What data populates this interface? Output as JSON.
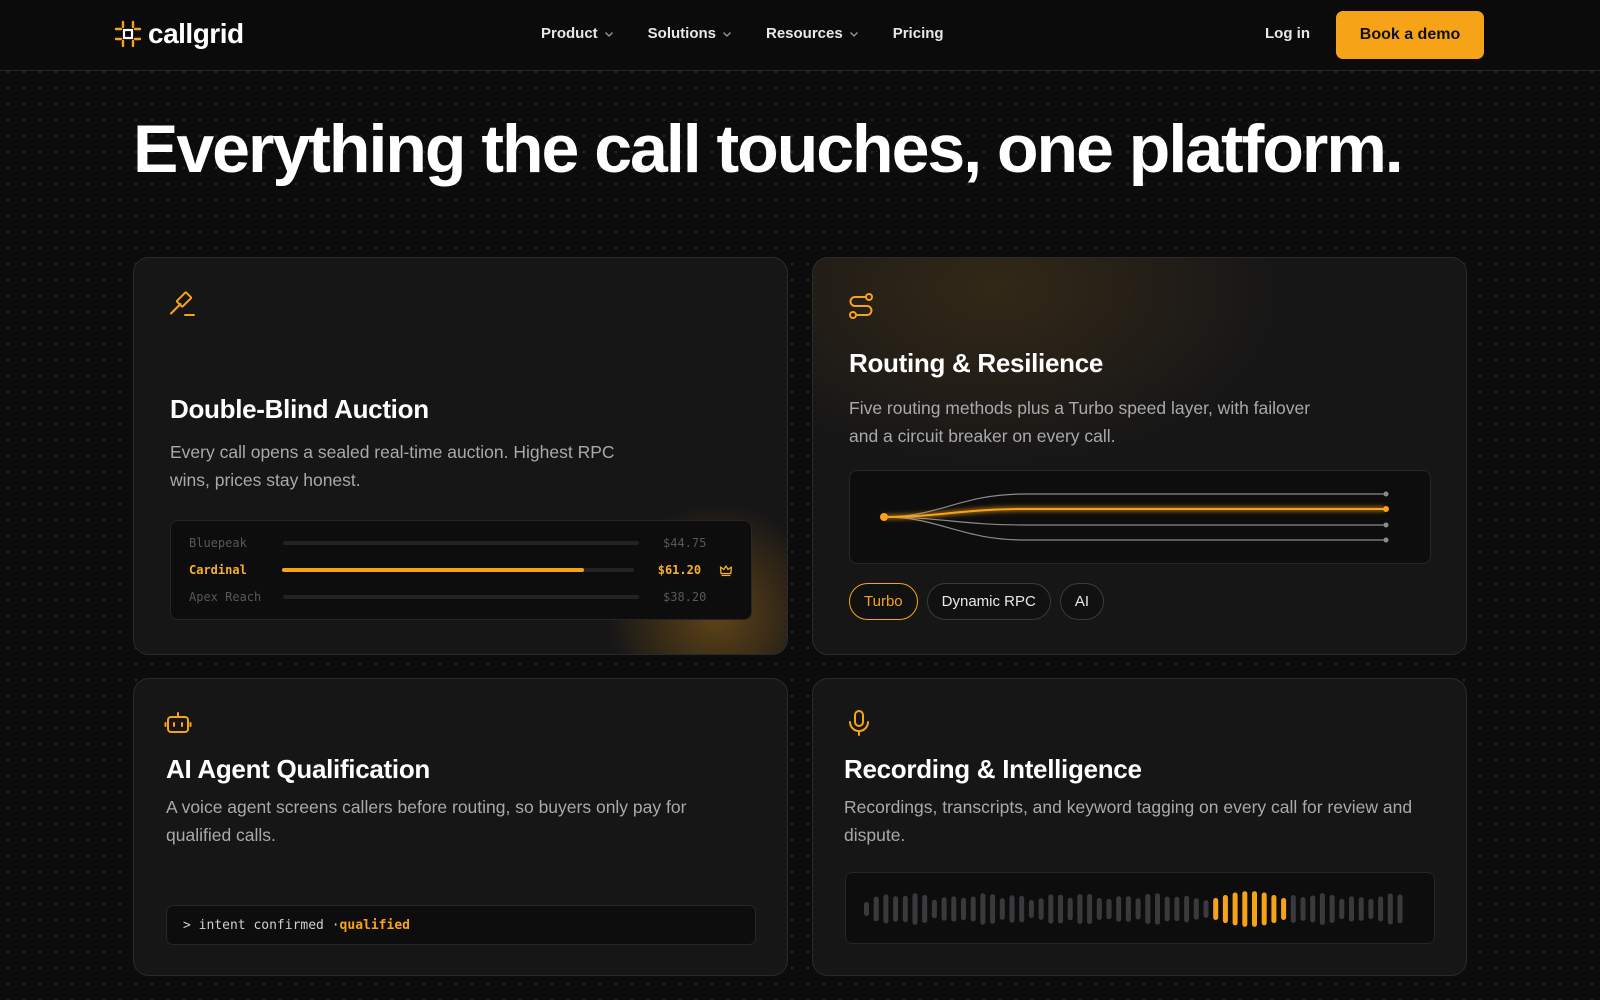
{
  "nav": {
    "logo_text": "callgrid",
    "links": [
      {
        "label": "Product",
        "dropdown": true
      },
      {
        "label": "Solutions",
        "dropdown": true
      },
      {
        "label": "Resources",
        "dropdown": true
      },
      {
        "label": "Pricing",
        "dropdown": false
      }
    ],
    "login_label": "Log in",
    "demo_label": "Book a demo"
  },
  "hero": {
    "headline": "Everything the call touches, one platform."
  },
  "colors": {
    "accent": "#f7a318",
    "background": "#0c0c0d",
    "card": "#161617",
    "muted_text": "#a9a9ad"
  },
  "cards": [
    {
      "icon": "gavel-icon",
      "title": "Double-Blind Auction",
      "desc": "Every call opens a sealed real-time auction. Highest RPC wins, prices stay honest.",
      "bids": [
        {
          "name": "Bluepeak",
          "amount": "$44.75",
          "winner": false,
          "fill": 0
        },
        {
          "name": "Cardinal",
          "amount": "$61.20",
          "winner": true,
          "fill": 0.86
        },
        {
          "name": "Apex Reach",
          "amount": "$38.20",
          "winner": false,
          "fill": 0
        }
      ]
    },
    {
      "icon": "route-icon",
      "title": "Routing & Resilience",
      "desc": "Five routing methods plus a Turbo speed layer, with failover and a circuit breaker on every call.",
      "chips": [
        {
          "label": "Turbo",
          "active": true
        },
        {
          "label": "Dynamic RPC",
          "active": false
        },
        {
          "label": "AI",
          "active": false
        }
      ]
    },
    {
      "icon": "bot-icon",
      "title": "AI Agent Qualification",
      "desc": "A voice agent screens callers before routing, so buyers only pay for qualified calls.",
      "terminal_prefix": "> intent confirmed ·",
      "terminal_status": "qualified"
    },
    {
      "icon": "mic-icon",
      "title": "Recording & Intelligence",
      "desc": "Recordings, transcripts, and keyword tagging on every call for review and dispute."
    }
  ]
}
